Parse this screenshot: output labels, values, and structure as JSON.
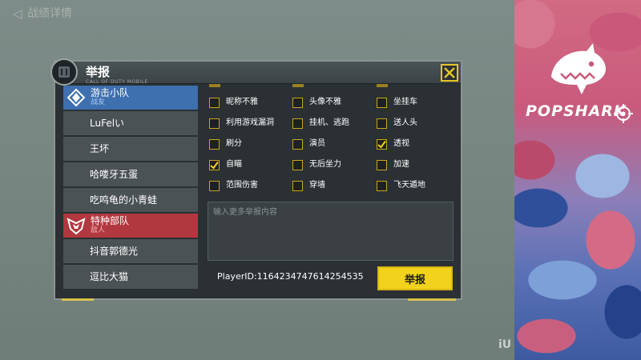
{
  "topbar": {
    "back_arrow": "◁",
    "title": "战绩详情"
  },
  "brand": {
    "name": "POPSHARK"
  },
  "dialog": {
    "title": "举报",
    "subtitle": "CALL OF DUTY MOBILE",
    "close": "X"
  },
  "teams": [
    {
      "name": "游击小队",
      "tag": "战友",
      "side": "ally",
      "players": [
        "LuFelい",
        "王坏",
        "哈喽牙五蛋",
        "吃鸣龟的小青蛙"
      ]
    },
    {
      "name": "特种部队",
      "tag": "敌人",
      "side": "enemy",
      "players": [
        "抖音郭德光",
        "逗比大猫"
      ]
    }
  ],
  "reasons": [
    {
      "label": "昵称不雅",
      "checked": false
    },
    {
      "label": "头像不雅",
      "checked": false
    },
    {
      "label": "坐挂车",
      "checked": false
    },
    {
      "label": "利用游戏漏洞",
      "checked": false
    },
    {
      "label": "挂机、逃跑",
      "checked": false
    },
    {
      "label": "送人头",
      "checked": false
    },
    {
      "label": "刷分",
      "checked": false
    },
    {
      "label": "演员",
      "checked": false
    },
    {
      "label": "透视",
      "checked": true
    },
    {
      "label": "自瞄",
      "checked": true
    },
    {
      "label": "无后坐力",
      "checked": false
    },
    {
      "label": "加速",
      "checked": false
    },
    {
      "label": "范围伤害",
      "checked": false
    },
    {
      "label": "穿墙",
      "checked": false
    },
    {
      "label": "飞天遁地",
      "checked": false
    }
  ],
  "textarea": {
    "placeholder": "输入更多举报内容"
  },
  "player_id": "PlayerID:1164234747614254535",
  "report_button": "举报",
  "colors": {
    "accent_yellow": "#f2d21c",
    "ally_blue": "#3e6fae",
    "enemy_red": "#b2383f",
    "checkbox_border": "#c9a51e"
  }
}
